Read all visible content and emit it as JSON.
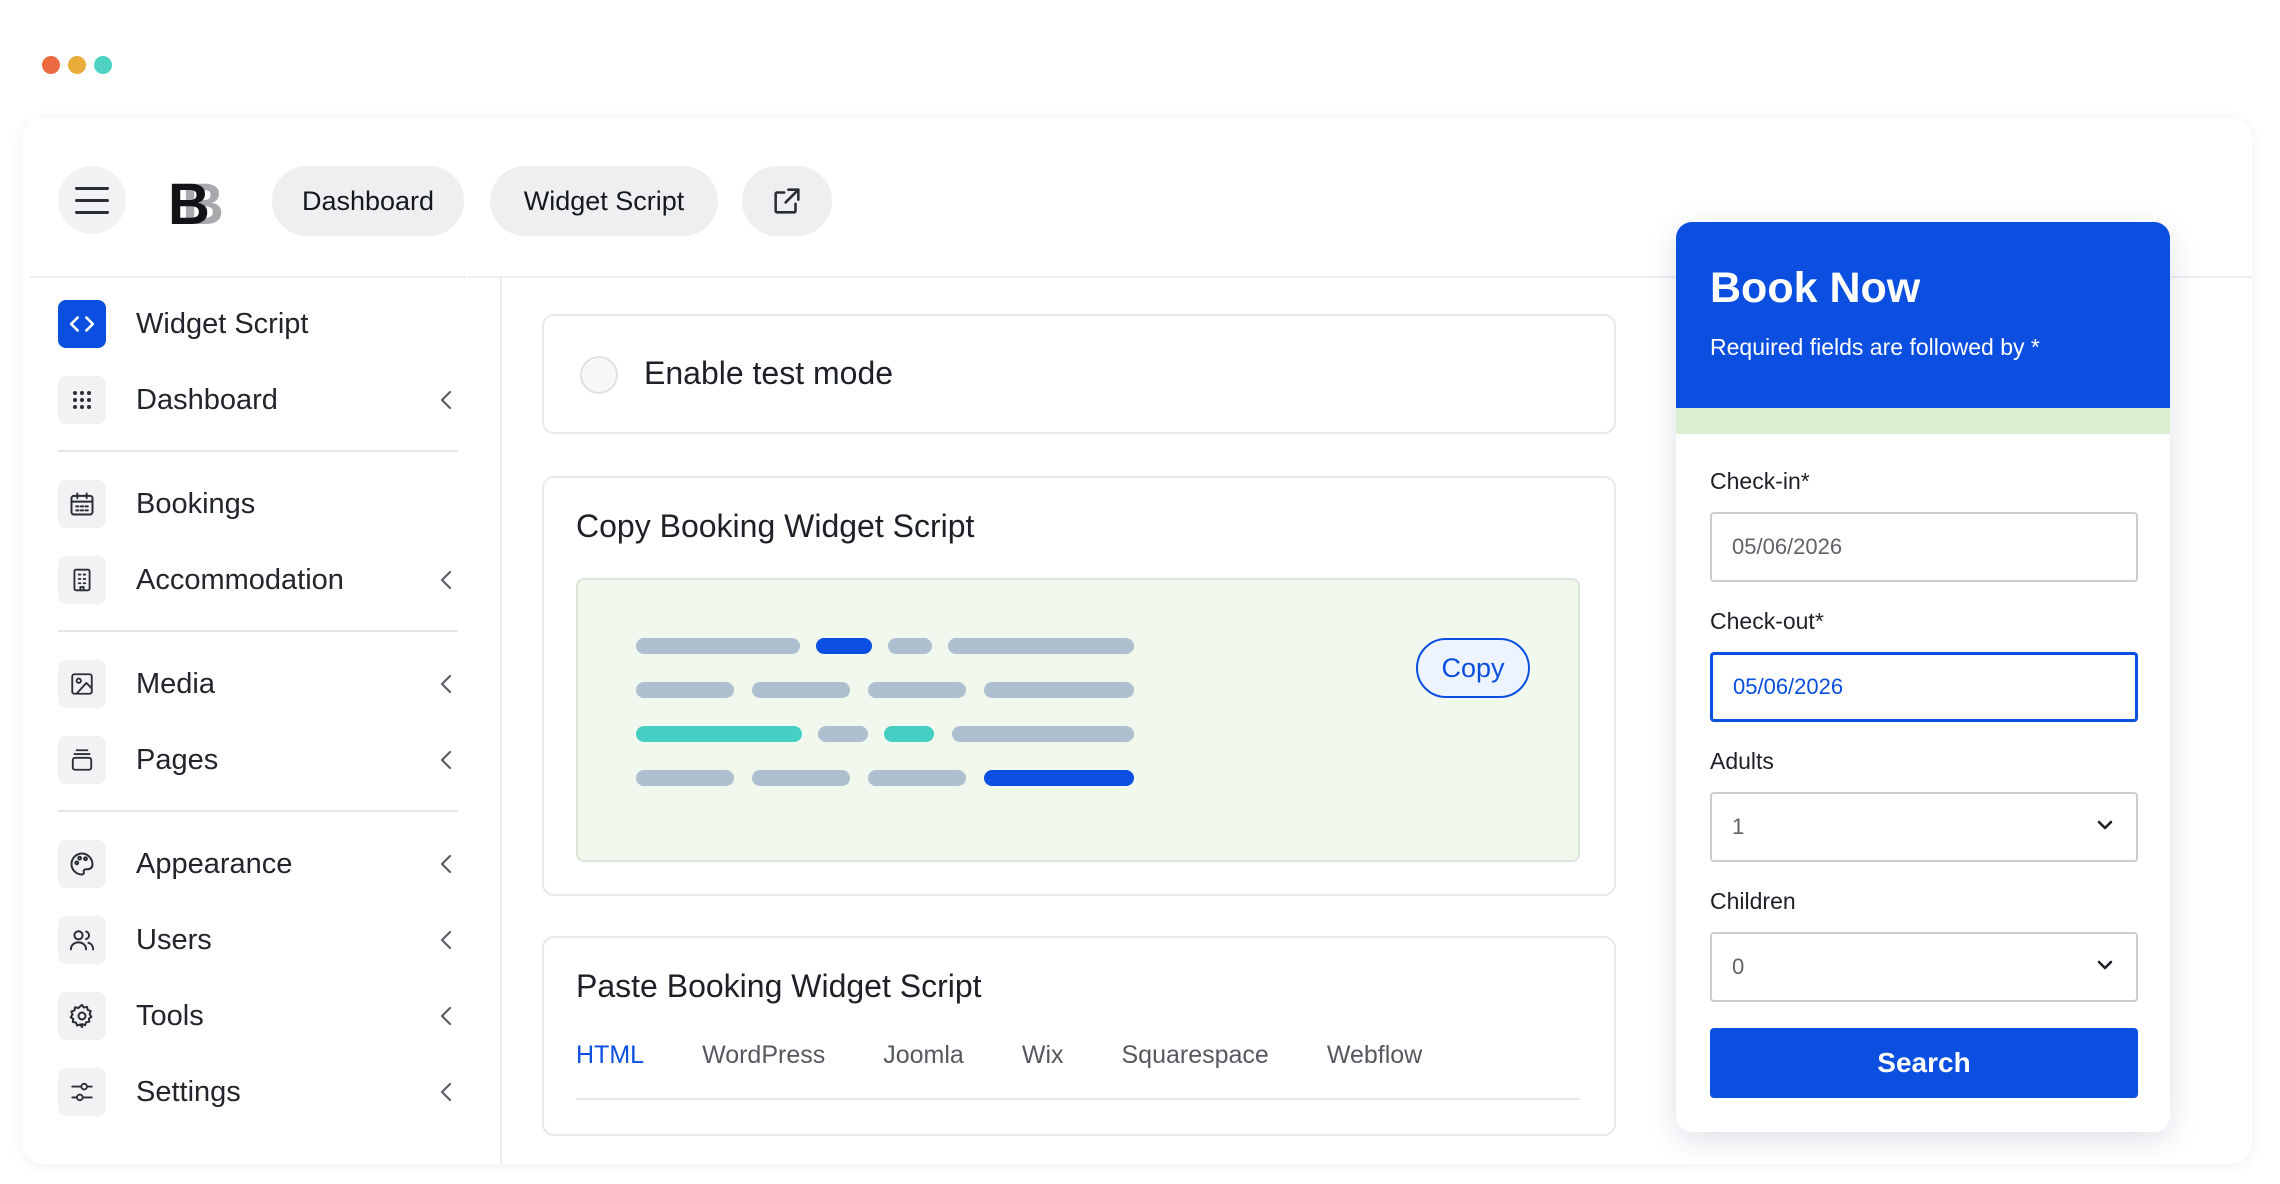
{
  "window": {
    "dots": [
      {
        "name": "close",
        "color": "#ec6a3f"
      },
      {
        "name": "minimize",
        "color": "#e9ad3c"
      },
      {
        "name": "zoom",
        "color": "#4fd2c2"
      }
    ]
  },
  "colors": {
    "accent": "#0a4fe0",
    "teal": "#45cfc4",
    "code_gray": "#aebfd0",
    "code_bg": "#f1f8ee",
    "strip": "#d9efcf"
  },
  "topbar": {
    "menu_icon": "hamburger-icon",
    "logo_icon": "bb-logo",
    "dashboard_label": "Dashboard",
    "widget_label": "Widget Script",
    "external_icon": "external-link-icon"
  },
  "sidebar": {
    "items": [
      {
        "label": "Widget Script",
        "icon": "code-icon",
        "active": true,
        "chevron": false
      },
      {
        "label": "Dashboard",
        "icon": "grid-dots-icon",
        "active": false,
        "chevron": true
      },
      {
        "label": "Bookings",
        "icon": "calendar-icon",
        "active": false,
        "chevron": false
      },
      {
        "label": "Accommodation",
        "icon": "building-icon",
        "active": false,
        "chevron": true
      },
      {
        "label": "Media",
        "icon": "image-icon",
        "active": false,
        "chevron": true
      },
      {
        "label": "Pages",
        "icon": "pages-icon",
        "active": false,
        "chevron": true
      },
      {
        "label": "Appearance",
        "icon": "palette-icon",
        "active": false,
        "chevron": true
      },
      {
        "label": "Users",
        "icon": "users-icon",
        "active": false,
        "chevron": true
      },
      {
        "label": "Tools",
        "icon": "gear-icon",
        "active": false,
        "chevron": true
      },
      {
        "label": "Settings",
        "icon": "sliders-icon",
        "active": false,
        "chevron": true
      }
    ]
  },
  "main": {
    "test_mode_label": "Enable test mode",
    "copy_title": "Copy Booking Widget Script",
    "copy_button": "Copy",
    "paste_title": "Paste Booking Widget Script",
    "tabs": [
      {
        "label": "HTML",
        "active": true
      },
      {
        "label": "WordPress",
        "active": false
      },
      {
        "label": "Joomla",
        "active": false
      },
      {
        "label": "Wix",
        "active": false
      },
      {
        "label": "Squarespace",
        "active": false
      },
      {
        "label": "Webflow",
        "active": false
      }
    ]
  },
  "widget": {
    "title": "Book Now",
    "subtitle": "Required fields are followed by *",
    "checkin_label": "Check-in*",
    "checkin_value": "05/06/2026",
    "checkout_label": "Check-out*",
    "checkout_value": "05/06/2026",
    "adults_label": "Adults",
    "adults_value": "1",
    "children_label": "Children",
    "children_value": "0",
    "search_label": "Search"
  }
}
